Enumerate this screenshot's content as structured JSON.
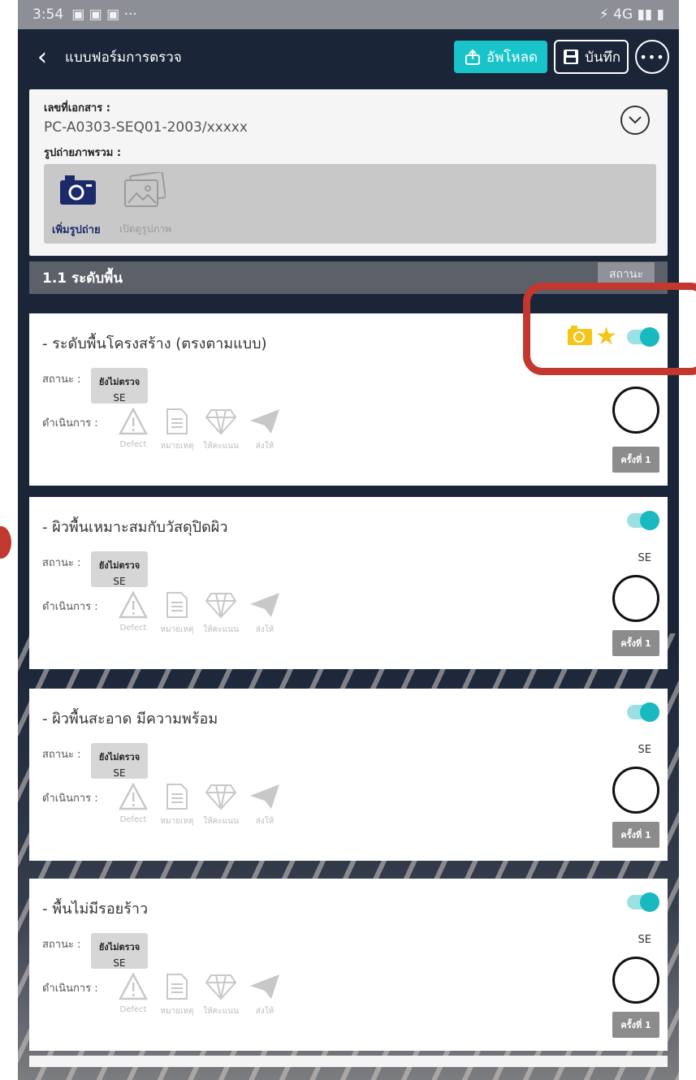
{
  "status_bar": {
    "time": "3:54",
    "icons_left": "▣ ▣ ▣  ···",
    "icons_right": "⚡ 4G ▮▮ ▮"
  },
  "appbar": {
    "title": "แบบฟอร์มการตรวจ",
    "upload_label": "อัพโหลด",
    "save_label": "บันทึก",
    "more_label": "•••"
  },
  "document": {
    "number_label": "เลขที่เอกสาร :",
    "number_value": "PC-A0303-SEQ01-2003/xxxxx",
    "photos_label": "รูปถ่ายภาพรวม :",
    "add_photo_label": "เพิ่มรูปถ่าย",
    "view_photos_label": "เปิดดูรูปภาพ"
  },
  "section": {
    "name": "1.1 ระดับพื้น",
    "status_label": "สถานะ"
  },
  "items": [
    {
      "name": "- ระดับพื้นโครงสร้าง (ตรงตามแบบ)",
      "status_label": "สถานะ :",
      "status_text": "ยังไม่ตรวจ",
      "status_code": "SE",
      "action_label": "ดำเนินการ :",
      "se": "",
      "round": "ครั้งที่ 1",
      "toggle_on": true,
      "has_extras": true
    },
    {
      "name": "- ผิวพื้นเหมาะสมกับวัสดุปิดผิว",
      "status_label": "สถานะ :",
      "status_text": "ยังไม่ตรวจ",
      "status_code": "SE",
      "action_label": "ดำเนินการ :",
      "se": "SE",
      "round": "ครั้งที่ 1",
      "toggle_on": true,
      "has_extras": false
    },
    {
      "name": "- ผิวพื้นสะอาด มีความพร้อม",
      "status_label": "สถานะ :",
      "status_text": "ยังไม่ตรวจ",
      "status_code": "SE",
      "action_label": "ดำเนินการ :",
      "se": "SE",
      "round": "ครั้งที่ 1",
      "toggle_on": true,
      "has_extras": false
    },
    {
      "name": "- พื้นไม่มีรอยร้าว",
      "status_label": "สถานะ :",
      "status_text": "ยังไม่ตรวจ",
      "status_code": "SE",
      "action_label": "ดำเนินการ :",
      "se": "SE",
      "round": "ครั้งที่ 1",
      "toggle_on": true,
      "has_extras": false
    }
  ],
  "actions": [
    {
      "label": "Defect",
      "icon": "warning-icon"
    },
    {
      "label": "หมายเหตุ",
      "icon": "note-icon"
    },
    {
      "label": "ให้คะแนน",
      "icon": "diamond-icon"
    },
    {
      "label": "ส่งให้",
      "icon": "send-icon"
    }
  ],
  "colors": {
    "app_bg": "#1a2538",
    "accent": "#18c4c9",
    "highlight": "#c2382f",
    "star": "#f5c518"
  }
}
